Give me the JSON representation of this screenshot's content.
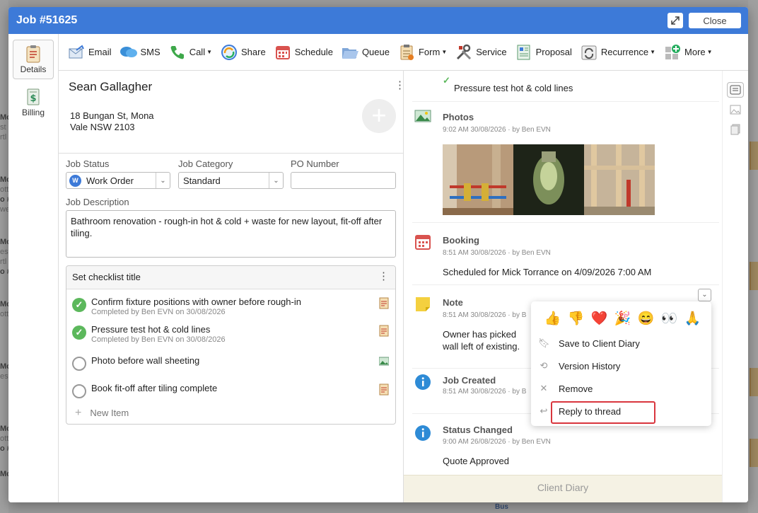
{
  "background_tokens": [
    "Mo",
    "st",
    "rtl",
    "o #",
    "we",
    "Mo",
    "ott",
    "o #",
    "est",
    "Bus",
    "Yarr"
  ],
  "modal": {
    "title": "Job #51625",
    "close_label": "Close"
  },
  "sidenav": {
    "items": [
      {
        "label": "Details",
        "icon": "clipboard-icon",
        "active": true
      },
      {
        "label": "Billing",
        "icon": "invoice-dollar-icon",
        "active": false
      }
    ]
  },
  "toolbar": {
    "items": [
      {
        "label": "Email",
        "icon": "email-icon"
      },
      {
        "label": "SMS",
        "icon": "sms-icon"
      },
      {
        "label": "Call",
        "icon": "phone-icon",
        "dropdown": true
      },
      {
        "label": "Share",
        "icon": "share-icon"
      },
      {
        "label": "Schedule",
        "icon": "calendar-icon"
      },
      {
        "label": "Queue",
        "icon": "folder-icon"
      },
      {
        "label": "Form",
        "icon": "form-icon",
        "dropdown": true
      },
      {
        "label": "Service",
        "icon": "tools-icon"
      },
      {
        "label": "Proposal",
        "icon": "proposal-icon"
      },
      {
        "label": "Recurrence",
        "icon": "recurrence-icon",
        "dropdown": true
      },
      {
        "label": "More",
        "icon": "more-icon",
        "dropdown": true
      }
    ]
  },
  "client": {
    "name": "Sean Gallagher",
    "address_line1": "18 Bungan St, Mona",
    "address_line2": "Vale NSW 2103"
  },
  "fields": {
    "job_status_label": "Job Status",
    "job_status_value": "Work Order",
    "job_status_badge": "W",
    "job_category_label": "Job Category",
    "job_category_value": "Standard",
    "po_number_label": "PO Number",
    "po_number_value": "",
    "job_description_label": "Job Description",
    "job_description_value": "Bathroom renovation - rough-in hot & cold + waste for new layout, fit-off after tiling."
  },
  "checklist": {
    "title": "Set checklist title",
    "items": [
      {
        "title": "Confirm fixture positions with owner before rough-in",
        "sub": "Completed by Ben EVN on 30/08/2026",
        "done": true,
        "icon": "form-doc-icon"
      },
      {
        "title": "Pressure test hot & cold lines",
        "sub": "Completed by Ben EVN on 30/08/2026",
        "done": true,
        "icon": "form-doc-icon"
      },
      {
        "title": "Photo before wall sheeting",
        "sub": "",
        "done": false,
        "icon": "photo-icon"
      },
      {
        "title": "Book fit-off after tiling complete",
        "sub": "",
        "done": false,
        "icon": "form-doc-icon"
      }
    ],
    "new_item_label": "New Item"
  },
  "feed": {
    "top_partial": "Pressure test hot & cold lines",
    "items": [
      {
        "title": "Photos",
        "meta": "9:02 AM 30/08/2026 · by Ben EVN",
        "body": "",
        "icon": "photo-icon"
      },
      {
        "title": "Booking",
        "meta": "8:51 AM 30/08/2026 · by Ben EVN",
        "body": "Scheduled for Mick Torrance on 4/09/2026 7:00 AM",
        "icon": "calendar-icon"
      },
      {
        "title": "Note",
        "meta": "8:51 AM 30/08/2026 · by B",
        "body": "Owner has picked wall left of existing.",
        "icon": "sticky-note-icon"
      },
      {
        "title": "Job Created",
        "meta": "8:51 AM 30/08/2026 · by B",
        "body": "",
        "icon": "info-icon"
      },
      {
        "title": "Status Changed",
        "meta": "9:00 AM 26/08/2026 · by Ben EVN",
        "body": "Quote Approved",
        "icon": "info-icon"
      }
    ],
    "client_diary_label": "Client Diary"
  },
  "context_menu": {
    "reactions": [
      "👍",
      "👎",
      "❤️",
      "🎉",
      "😄",
      "👀",
      "🙏"
    ],
    "items": [
      {
        "label": "Save to Client Diary",
        "icon": "bookmark-icon"
      },
      {
        "label": "Version History",
        "icon": "history-icon"
      },
      {
        "label": "Remove",
        "icon": "close-icon"
      },
      {
        "label": "Reply to thread",
        "icon": "reply-icon"
      }
    ]
  },
  "colors": {
    "titlebar": "#3d7ad8",
    "check_done": "#5cb85c",
    "highlight": "#d9363e",
    "diary_bg": "#f5f2e4"
  }
}
